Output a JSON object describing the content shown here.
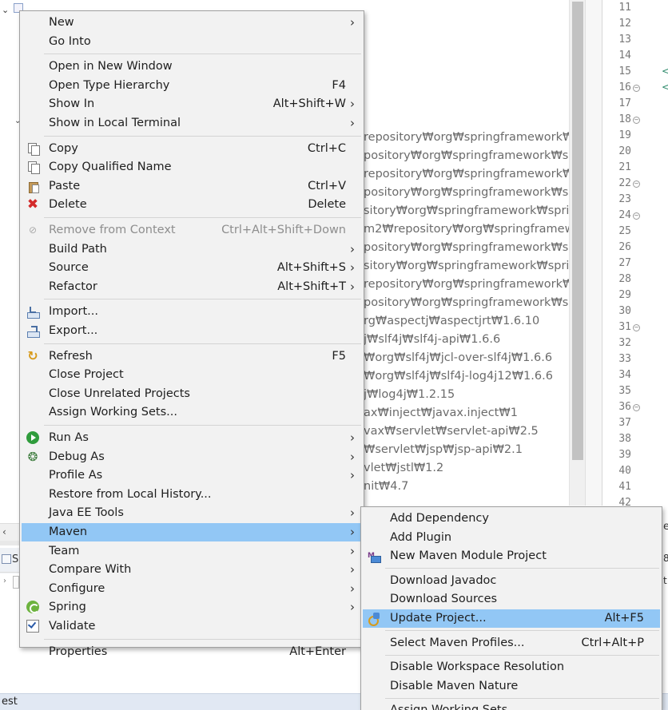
{
  "workspace": {
    "editor_paths": [
      "repository₩org₩springframework₩sp",
      "pository₩org₩springframework₩sprin",
      "repository₩org₩springframework₩spr",
      "pository₩org₩springframework₩sprin",
      "sitory₩org₩springframework₩spring-",
      "m2₩repository₩org₩springframework",
      "pository₩org₩springframework₩sprin",
      "sitory₩org₩springframework₩spring-",
      "repository₩org₩springframework₩s",
      "pository₩org₩springframework₩sprin",
      "rg₩aspectj₩aspectjrt₩1.6.10",
      "j₩slf4j₩slf4j-api₩1.6.6",
      "₩org₩slf4j₩jcl-over-slf4j₩1.6.6",
      "₩org₩slf4j₩slf4j-log4j12₩1.6.6",
      "j₩log4j₩1.2.15",
      "ax₩inject₩javax.inject₩1",
      "vax₩servlet₩servlet-api₩2.5",
      "₩servlet₩jsp₩jsp-api₩2.1",
      "vlet₩jstl₩1.2",
      "nit₩4.7"
    ],
    "line_numbers": [
      "11",
      "12",
      "13",
      "14",
      "15",
      "16",
      "17",
      "18",
      "19",
      "20",
      "21",
      "22",
      "23",
      "24",
      "25",
      "26",
      "27",
      "28",
      "29",
      "30",
      "31",
      "32",
      "33",
      "34",
      "35",
      "36",
      "37",
      "38",
      "39",
      "40",
      "41",
      "42"
    ],
    "folded_lines": [
      "16",
      "18",
      "22",
      "24",
      "31",
      "36"
    ],
    "tag_marks_lines": [
      "15",
      "16"
    ],
    "tag_mark_char": "<",
    "lower_panel_label": "S",
    "status_text": "est",
    "right_edge_a": "e",
    "right_edge_b": "8",
    "right_edge_c": "t"
  },
  "context_menu": {
    "items": [
      {
        "label": "New",
        "submenu": true
      },
      {
        "label": "Go Into"
      },
      {
        "separator": true
      },
      {
        "label": "Open in New Window"
      },
      {
        "label": "Open Type Hierarchy",
        "shortcut": "F4"
      },
      {
        "label": "Show In",
        "shortcut": "Alt+Shift+W",
        "submenu": true
      },
      {
        "label": "Show in Local Terminal",
        "submenu": true
      },
      {
        "separator": true
      },
      {
        "label": "Copy",
        "shortcut": "Ctrl+C",
        "icon": "copy-icon"
      },
      {
        "label": "Copy Qualified Name",
        "icon": "copy-qualified-name-icon"
      },
      {
        "label": "Paste",
        "shortcut": "Ctrl+V",
        "icon": "paste-icon"
      },
      {
        "label": "Delete",
        "shortcut": "Delete",
        "icon": "delete-icon"
      },
      {
        "separator": true
      },
      {
        "label": "Remove from Context",
        "shortcut": "Ctrl+Alt+Shift+Down",
        "icon": "remove-from-context-icon",
        "disabled": true
      },
      {
        "label": "Build Path",
        "submenu": true
      },
      {
        "label": "Source",
        "shortcut": "Alt+Shift+S",
        "submenu": true
      },
      {
        "label": "Refactor",
        "shortcut": "Alt+Shift+T",
        "submenu": true
      },
      {
        "separator": true
      },
      {
        "label": "Import...",
        "icon": "import-icon"
      },
      {
        "label": "Export...",
        "icon": "export-icon"
      },
      {
        "separator": true
      },
      {
        "label": "Refresh",
        "shortcut": "F5",
        "icon": "refresh-icon"
      },
      {
        "label": "Close Project"
      },
      {
        "label": "Close Unrelated Projects"
      },
      {
        "label": "Assign Working Sets..."
      },
      {
        "separator": true
      },
      {
        "label": "Run As",
        "submenu": true,
        "icon": "run-icon"
      },
      {
        "label": "Debug As",
        "submenu": true,
        "icon": "debug-icon"
      },
      {
        "label": "Profile As",
        "submenu": true
      },
      {
        "label": "Restore from Local History..."
      },
      {
        "label": "Java EE Tools",
        "submenu": true
      },
      {
        "label": "Maven",
        "submenu": true,
        "highlighted": true
      },
      {
        "label": "Team",
        "submenu": true
      },
      {
        "label": "Compare With",
        "submenu": true
      },
      {
        "label": "Configure",
        "submenu": true
      },
      {
        "label": "Spring",
        "submenu": true,
        "icon": "spring-icon"
      },
      {
        "label": "Validate",
        "icon": "check-icon"
      },
      {
        "separator": true
      },
      {
        "label": "Properties",
        "shortcut": "Alt+Enter"
      }
    ]
  },
  "maven_submenu": {
    "items": [
      {
        "label": "Add Dependency"
      },
      {
        "label": "Add Plugin"
      },
      {
        "label": "New Maven Module Project",
        "icon": "maven-module-icon"
      },
      {
        "separator": true
      },
      {
        "label": "Download Javadoc"
      },
      {
        "label": "Download Sources"
      },
      {
        "label": "Update Project...",
        "shortcut": "Alt+F5",
        "highlighted": true,
        "icon": "update-project-icon"
      },
      {
        "separator": true
      },
      {
        "label": "Select Maven Profiles...",
        "shortcut": "Ctrl+Alt+P"
      },
      {
        "separator": true
      },
      {
        "label": "Disable Workspace Resolution"
      },
      {
        "label": "Disable Maven Nature"
      },
      {
        "separator": true
      },
      {
        "label": "Assign Working Sets..."
      }
    ]
  },
  "colors": {
    "highlight": "#92c7f5",
    "menu_bg": "#f2f2f2",
    "status_bar": "#e1e8f3"
  }
}
